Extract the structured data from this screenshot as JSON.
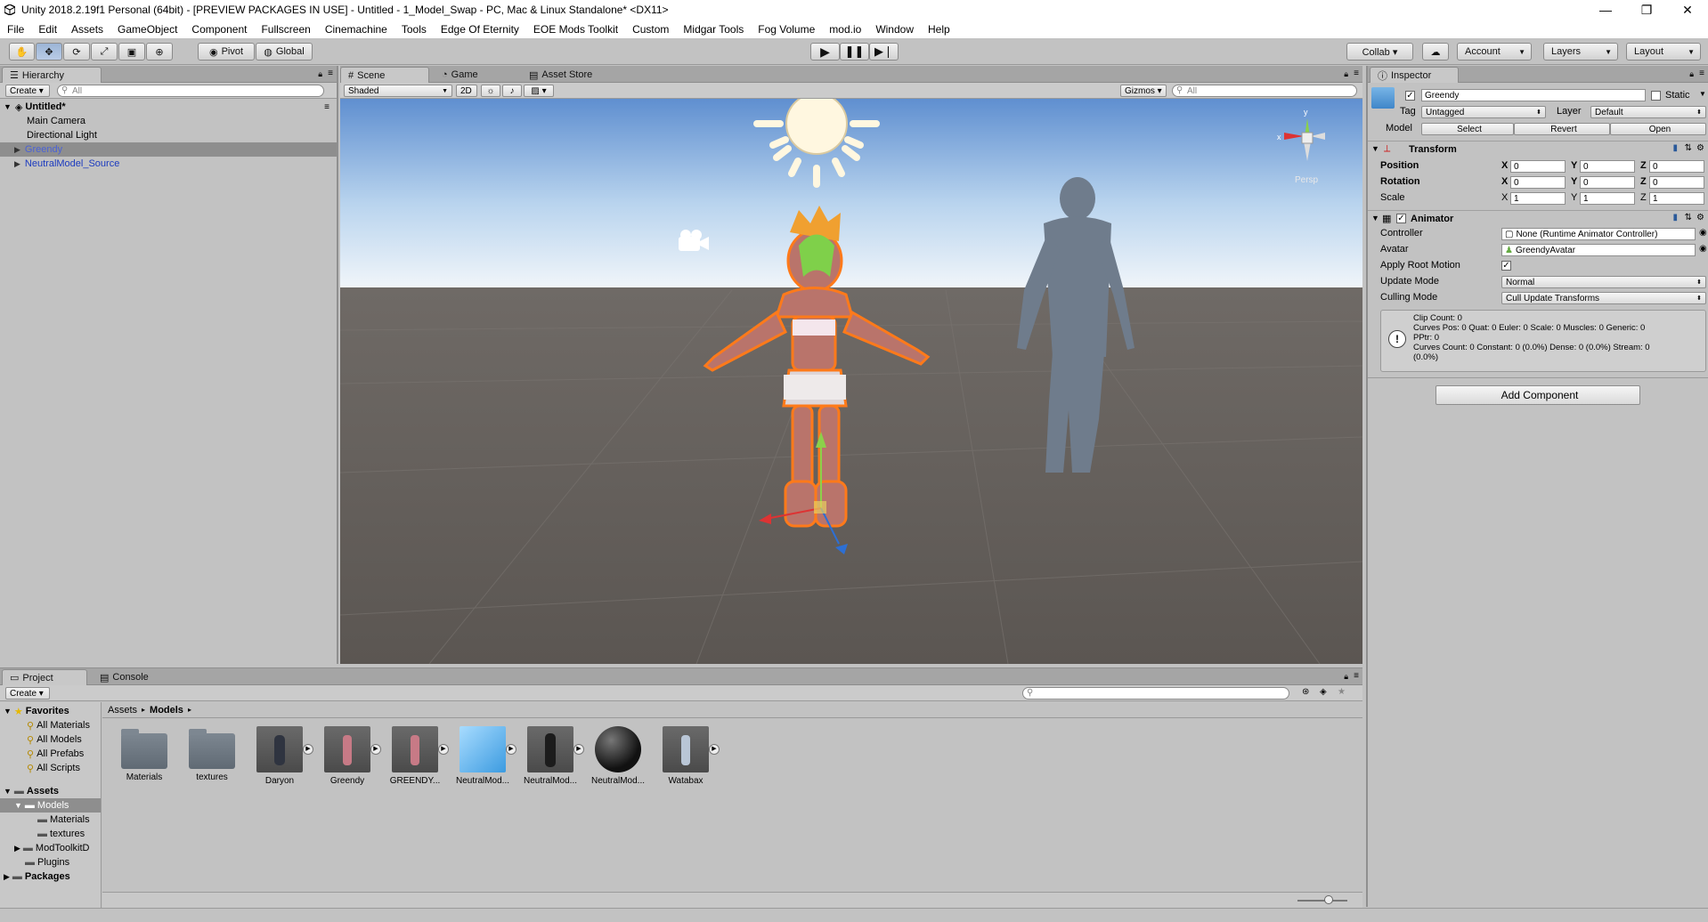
{
  "window": {
    "title": "Unity 2018.2.19f1 Personal (64bit) - [PREVIEW PACKAGES IN USE] - Untitled - 1_Model_Swap - PC, Mac & Linux Standalone* <DX11>",
    "minimize": "—",
    "maximize": "❐",
    "close": "✕"
  },
  "menu": [
    "File",
    "Edit",
    "Assets",
    "GameObject",
    "Component",
    "Fullscreen",
    "Cinemachine",
    "Tools",
    "Edge Of Eternity",
    "EOE Mods Toolkit",
    "Custom",
    "Midgar Tools",
    "Fog Volume",
    "mod.io",
    "Window",
    "Help"
  ],
  "toolbar": {
    "pivot": "Pivot",
    "global": "Global",
    "collab": "Collab ▾",
    "account": "Account",
    "layers": "Layers",
    "layout": "Layout"
  },
  "hierarchy": {
    "tab": "Hierarchy",
    "create": "Create ▾",
    "search_placeholder": "All",
    "scene": "Untitled*",
    "items": [
      "Main Camera",
      "Directional Light",
      "Greendy",
      "NeutralModel_Source"
    ]
  },
  "scene": {
    "tabs": [
      "Scene",
      "Game",
      "Asset Store"
    ],
    "shading": "Shaded",
    "mode2d": "2D",
    "gizmos": "Gizmos ▾",
    "search_placeholder": "All",
    "persp": "Persp"
  },
  "inspector": {
    "tab": "Inspector",
    "name": "Greendy",
    "static": "Static",
    "tag_label": "Tag",
    "tag": "Untagged",
    "layer_label": "Layer",
    "layer": "Default",
    "model_label": "Model",
    "select": "Select",
    "revert": "Revert",
    "open": "Open",
    "transform": {
      "title": "Transform",
      "position": "Position",
      "rotation": "Rotation",
      "scale": "Scale",
      "pos": [
        "0",
        "0",
        "0"
      ],
      "rot": [
        "0",
        "0",
        "0"
      ],
      "scl": [
        "1",
        "1",
        "1"
      ]
    },
    "animator": {
      "title": "Animator",
      "controller_label": "Controller",
      "controller": "None (Runtime Animator Controller)",
      "avatar_label": "Avatar",
      "avatar": "GreendyAvatar",
      "root_motion": "Apply Root Motion",
      "update_mode_label": "Update Mode",
      "update_mode": "Normal",
      "culling_label": "Culling Mode",
      "culling": "Cull Update Transforms",
      "info": [
        "Clip Count: 0",
        "Curves Pos: 0 Quat: 0 Euler: 0 Scale: 0 Muscles: 0 Generic: 0",
        "PPtr: 0",
        "Curves Count: 0 Constant: 0 (0.0%) Dense: 0 (0.0%) Stream: 0",
        "(0.0%)"
      ]
    },
    "add_component": "Add Component"
  },
  "project": {
    "tabs": [
      "Project",
      "Console"
    ],
    "create": "Create ▾",
    "breadcrumb": [
      "Assets",
      "Models"
    ],
    "favorites_title": "Favorites",
    "favorites": [
      "All Materials",
      "All Models",
      "All Prefabs",
      "All Scripts"
    ],
    "assets_title": "Assets",
    "tree": [
      "Models",
      "Materials",
      "textures",
      "ModToolkitD",
      "Plugins"
    ],
    "packages": "Packages",
    "assets": [
      "Materials",
      "textures",
      "Daryon",
      "Greendy",
      "GREENDY...",
      "NeutralMod...",
      "NeutralMod...",
      "NeutralMod...",
      "Watabax"
    ]
  }
}
